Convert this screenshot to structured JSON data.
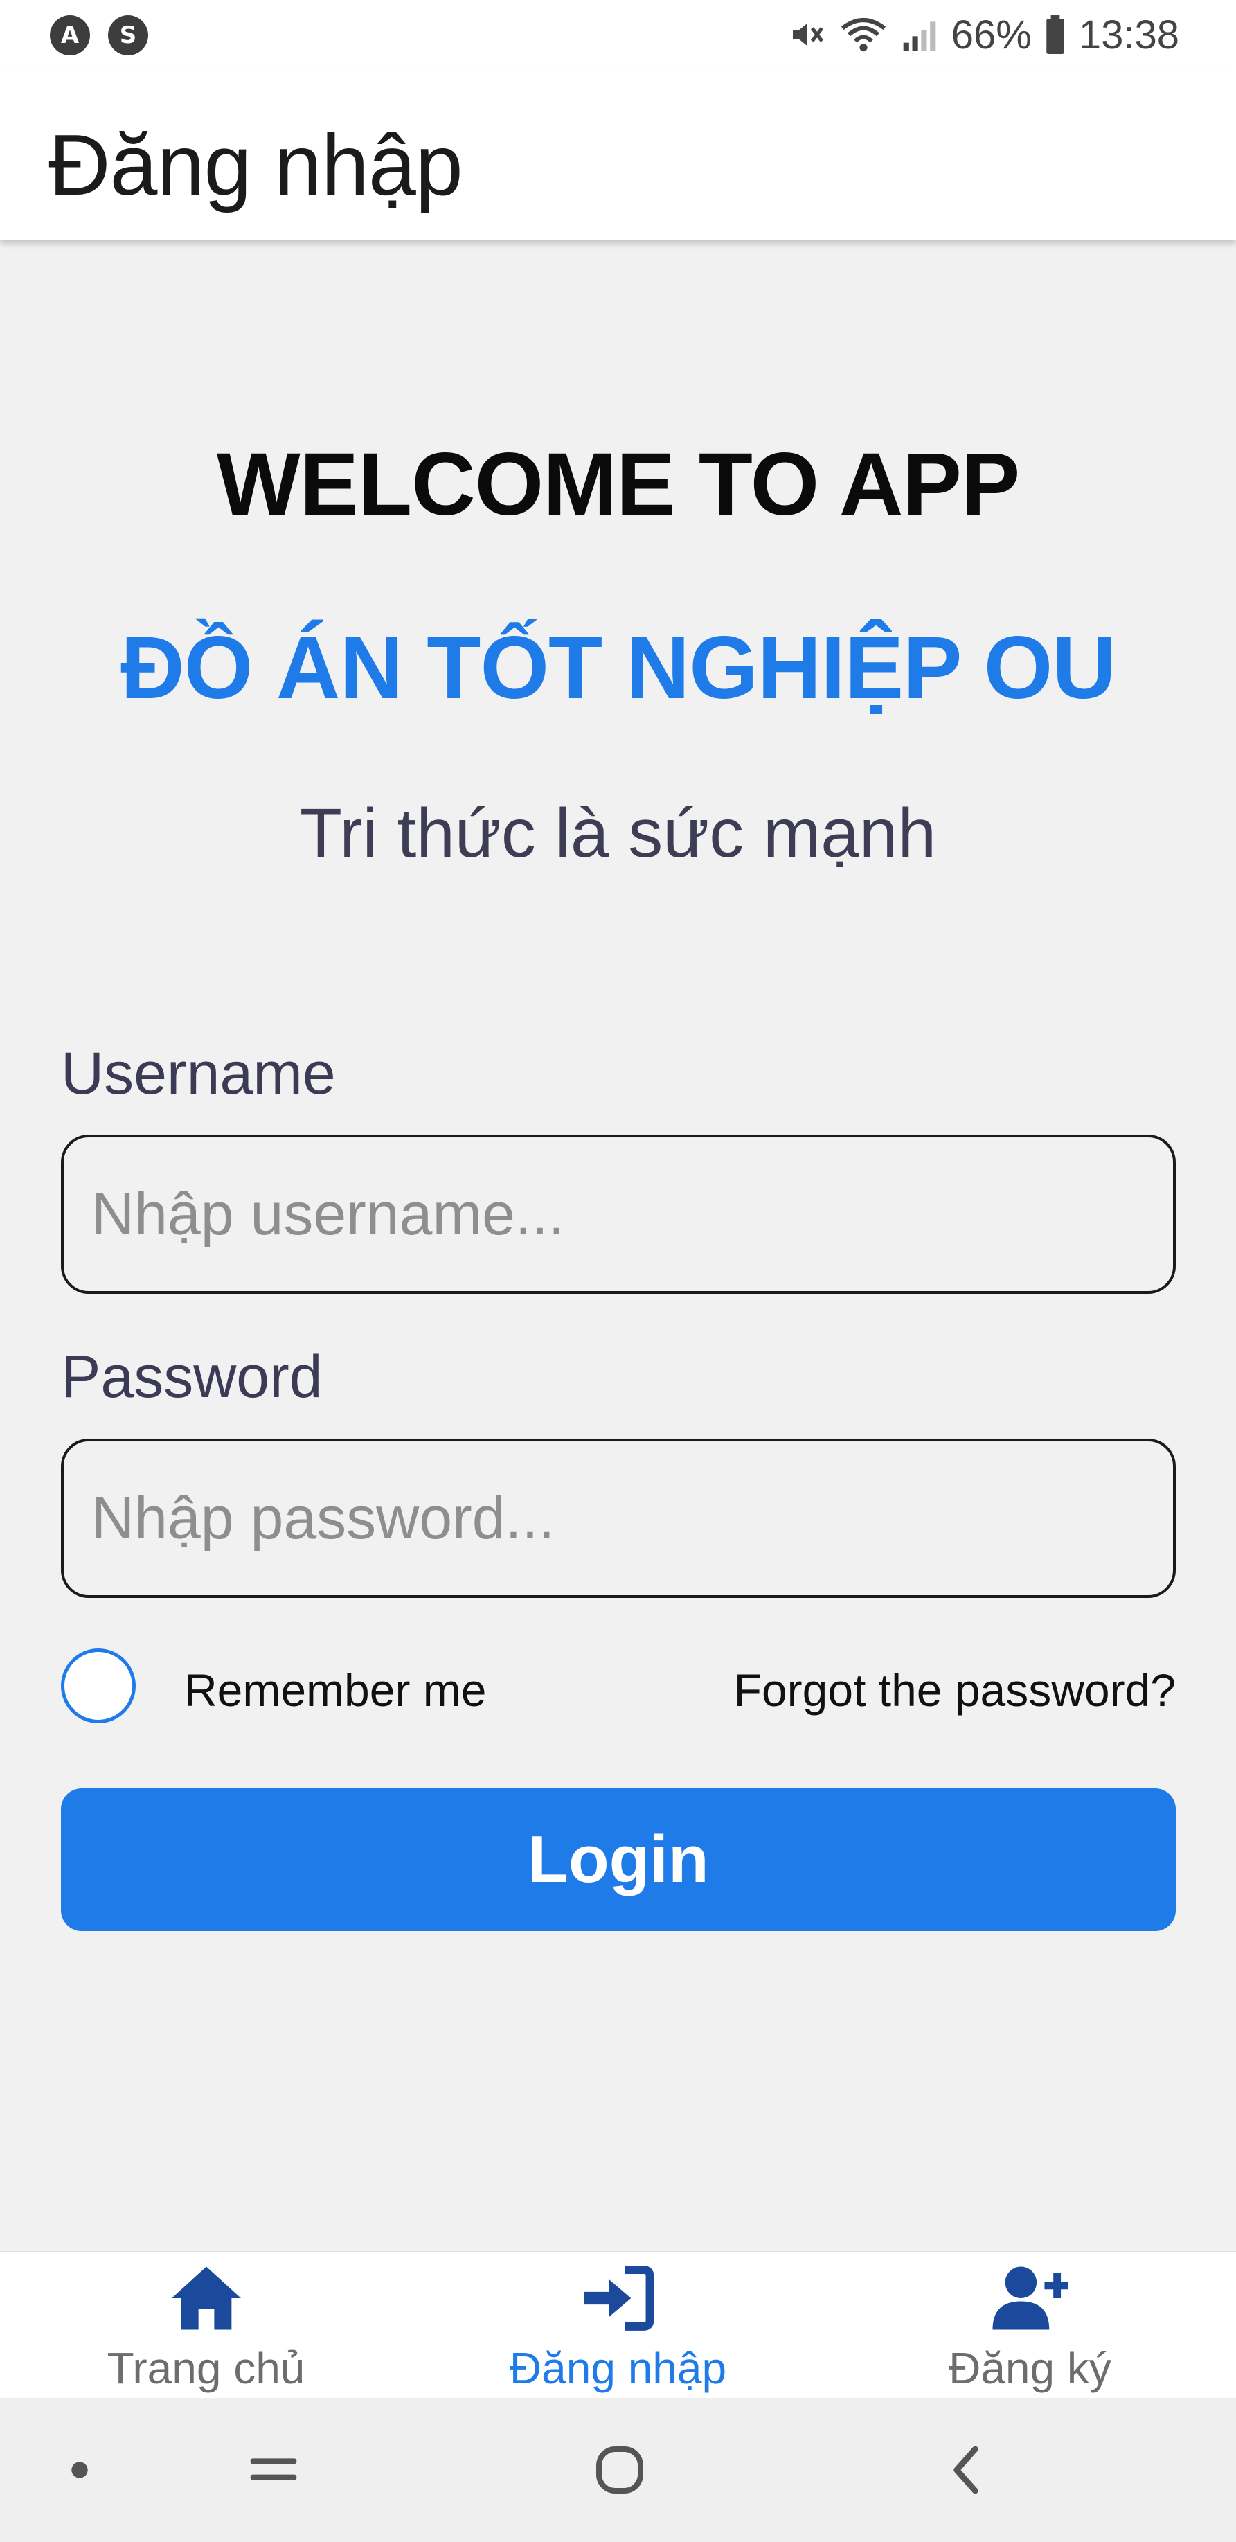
{
  "status_bar": {
    "notification_icons": [
      "A",
      "S"
    ],
    "battery": "66%",
    "time": "13:38"
  },
  "app_bar": {
    "title": "Đăng nhập"
  },
  "login": {
    "welcome": "WELCOME TO APP",
    "project": "ĐỒ ÁN TỐT NGHIỆP OU",
    "slogan": "Tri thức là sức mạnh",
    "username_label": "Username",
    "username_placeholder": "Nhập username...",
    "username_value": "",
    "password_label": "Password",
    "password_placeholder": "Nhập password...",
    "password_value": "",
    "remember_label": "Remember me",
    "remember_checked": false,
    "forgot_label": "Forgot the password?",
    "login_label": "Login"
  },
  "tabs": [
    {
      "label": "Trang chủ",
      "icon": "home-icon",
      "active": false
    },
    {
      "label": "Đăng nhập",
      "icon": "sign-in-icon",
      "active": true
    },
    {
      "label": "Đăng ký",
      "icon": "user-plus-icon",
      "active": false
    }
  ],
  "colors": {
    "accent": "#1e7be8",
    "tab_inactive_label": "#6d6d6d",
    "tab_icon": "#1b4a9c",
    "background": "#f1f1f1"
  }
}
